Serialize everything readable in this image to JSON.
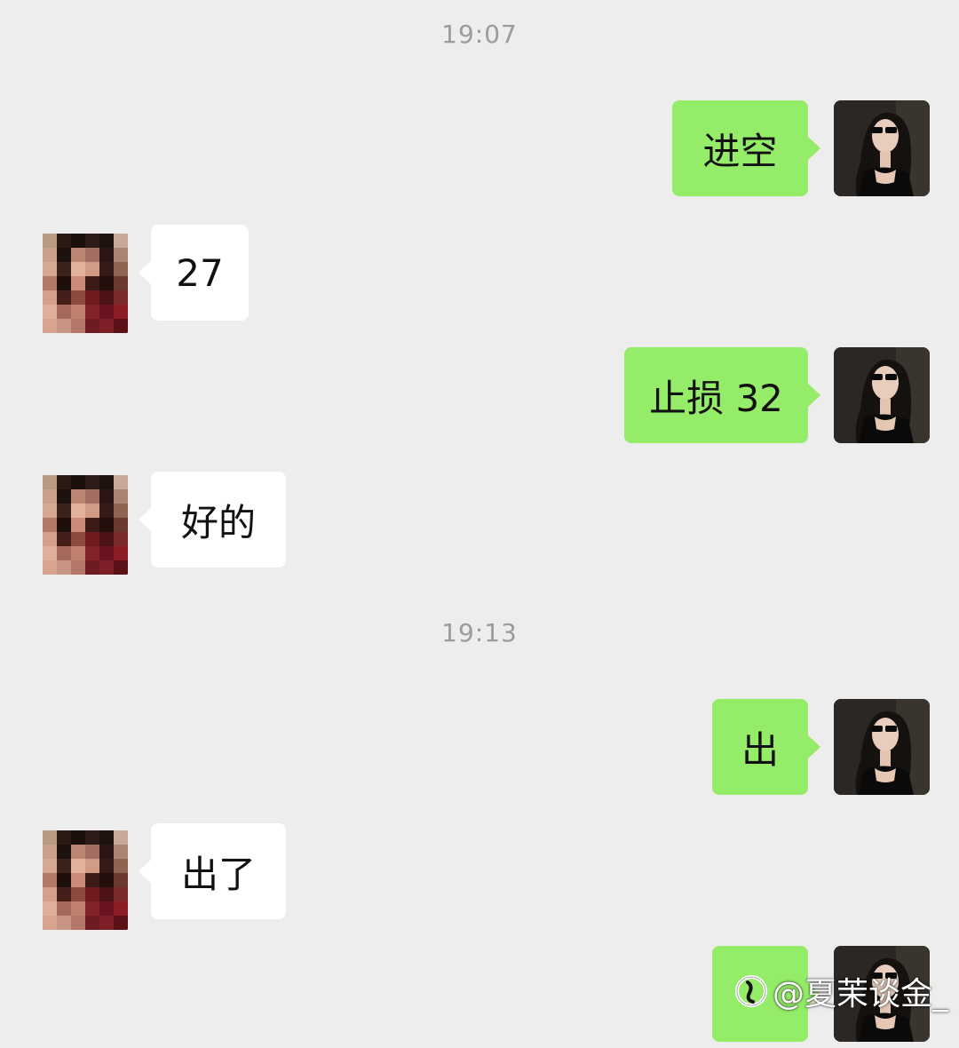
{
  "timestamps": [
    "19:07",
    "19:13"
  ],
  "messages": [
    {
      "sender": "self",
      "text": "进空"
    },
    {
      "sender": "other",
      "text": "27"
    },
    {
      "sender": "self",
      "text": "止损 32"
    },
    {
      "sender": "other",
      "text": "好的"
    },
    {
      "sender": "self",
      "text": "出"
    },
    {
      "sender": "other",
      "text": "出了"
    },
    {
      "sender": "self",
      "text": "",
      "obscured_by_watermark": true
    }
  ],
  "watermark": {
    "text": "@夏茉谈金_",
    "icon": "platform-logo-icon"
  },
  "colors": {
    "background": "#ededed",
    "self_bubble": "#95ec69",
    "other_bubble": "#ffffff",
    "timestamp": "#9b9b9b"
  },
  "avatars": {
    "self": "profile-photo-woman-sunglasses",
    "other": "pixelated-censored-avatar"
  }
}
